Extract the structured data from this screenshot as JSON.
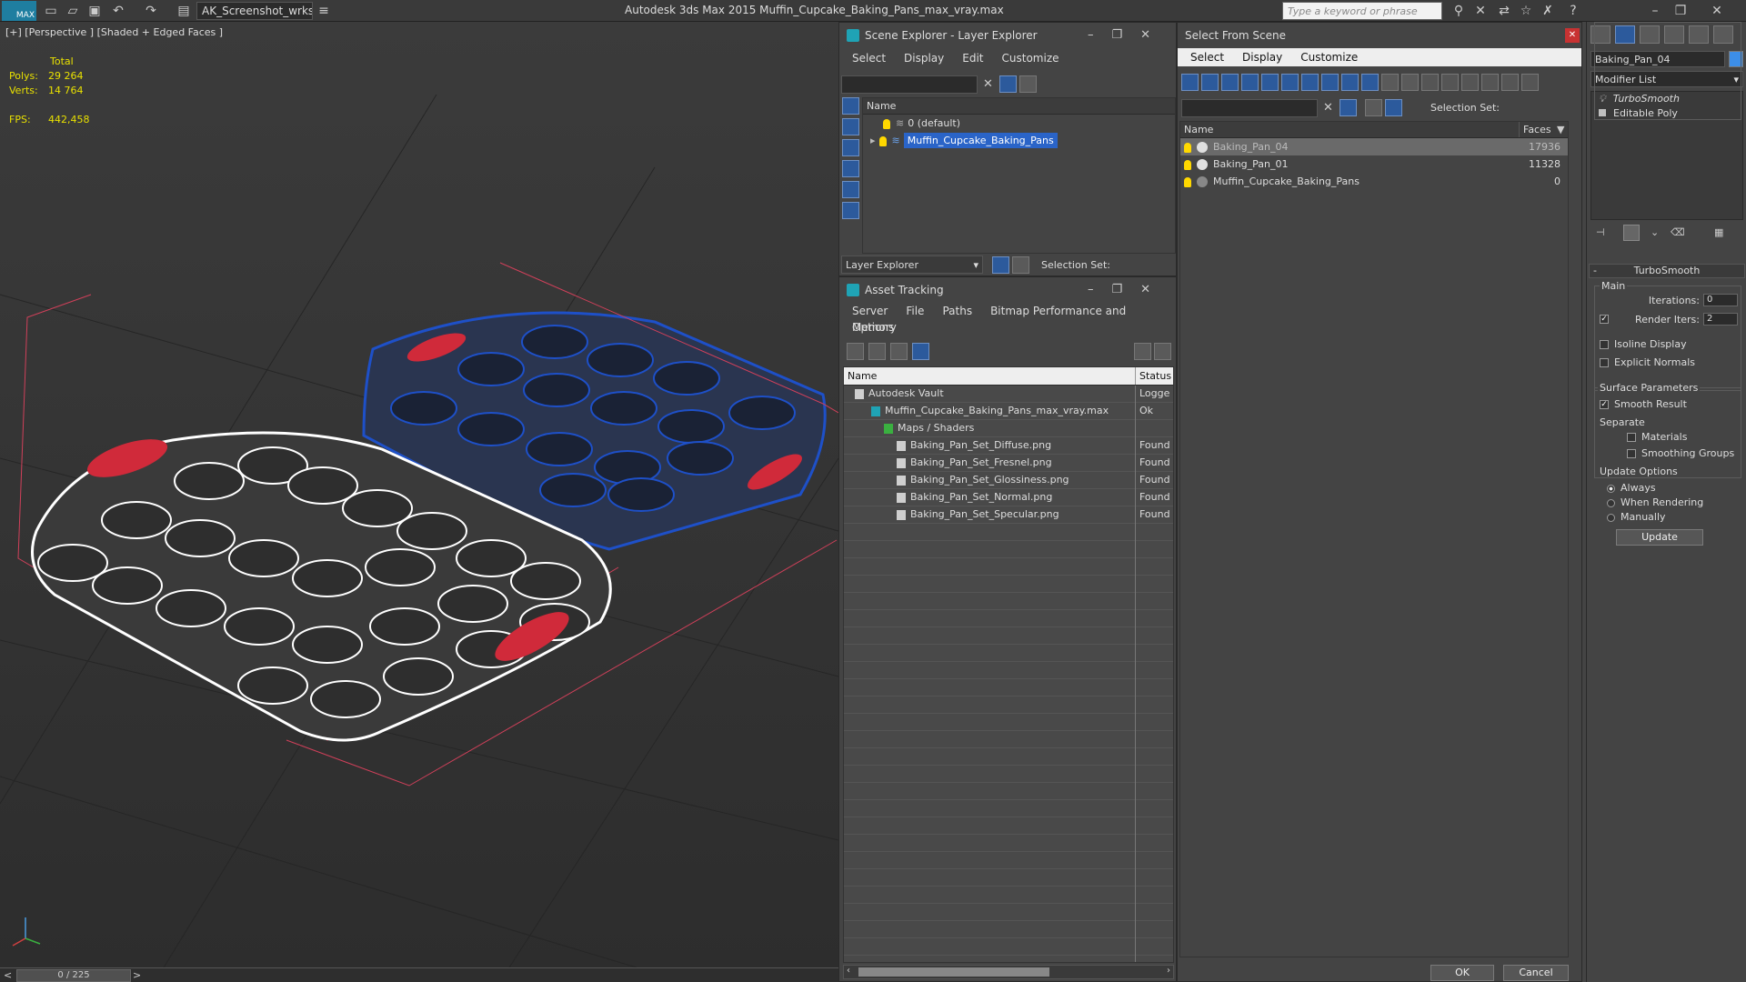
{
  "app": {
    "title": "Autodesk 3ds Max  2015    Muffin_Cupcake_Baking_Pans_max_vray.max",
    "workspace": "AK_Screenshot_wrksp",
    "search_placeholder": "Type a keyword or phrase",
    "logo": "MAX"
  },
  "viewport": {
    "label": "[+] [Perspective ] [Shaded + Edged Faces ]",
    "stats": {
      "header": "Total",
      "polys_label": "Polys:",
      "polys": "29 264",
      "verts_label": "Verts:",
      "verts": "14 764",
      "fps_label": "FPS:",
      "fps": "442,458"
    },
    "timeline": "0 / 225",
    "prev": "<",
    "next": ">"
  },
  "scene_explorer": {
    "title": "Scene Explorer - Layer Explorer",
    "menu": [
      "Select",
      "Display",
      "Edit",
      "Customize"
    ],
    "column": "Name",
    "rows": [
      "0 (default)",
      "Muffin_Cupcake_Baking_Pans"
    ],
    "footer_dropdown": "Layer Explorer",
    "selection_set": "Selection Set:"
  },
  "asset_tracking": {
    "title": "Asset Tracking",
    "menu": [
      "Server",
      "File",
      "Paths",
      "Bitmap Performance and Memory"
    ],
    "menu2": "Options",
    "col_name": "Name",
    "col_status": "Status",
    "rows": [
      {
        "name": "Autodesk Vault",
        "status": "Logge"
      },
      {
        "name": "Muffin_Cupcake_Baking_Pans_max_vray.max",
        "status": "Ok"
      },
      {
        "name": "Maps / Shaders",
        "status": ""
      },
      {
        "name": "Baking_Pan_Set_Diffuse.png",
        "status": "Found"
      },
      {
        "name": "Baking_Pan_Set_Fresnel.png",
        "status": "Found"
      },
      {
        "name": "Baking_Pan_Set_Glossiness.png",
        "status": "Found"
      },
      {
        "name": "Baking_Pan_Set_Normal.png",
        "status": "Found"
      },
      {
        "name": "Baking_Pan_Set_Specular.png",
        "status": "Found"
      }
    ]
  },
  "select_from_scene": {
    "title": "Select From Scene",
    "menu": [
      "Select",
      "Display",
      "Customize"
    ],
    "selection_set": "Selection Set:",
    "col_name": "Name",
    "col_faces": "Faces",
    "rows": [
      {
        "name": "Baking_Pan_04",
        "faces": "17936"
      },
      {
        "name": "Baking_Pan_01",
        "faces": "11328"
      },
      {
        "name": "Muffin_Cupcake_Baking_Pans",
        "faces": "0"
      }
    ],
    "ok": "OK",
    "cancel": "Cancel"
  },
  "command_panel": {
    "object_name": "Baking_Pan_04",
    "modifier_list": "Modifier List",
    "stack": [
      "TurboSmooth",
      "Editable Poly"
    ],
    "rollout": "TurboSmooth",
    "main": "Main",
    "iterations_label": "Iterations:",
    "iterations": "0",
    "render_iters_label": "Render Iters:",
    "render_iters": "2",
    "isoline": "Isoline Display",
    "explicit": "Explicit Normals",
    "surface": "Surface Parameters",
    "smooth": "Smooth Result",
    "separate": "Separate",
    "materials": "Materials",
    "smoothing": "Smoothing Groups",
    "update_options": "Update Options",
    "always": "Always",
    "when_rendering": "When Rendering",
    "manually": "Manually",
    "update": "Update",
    "rollout_minus": "-"
  },
  "colors": {
    "accent": "#2a64c8",
    "stats": "#e8e000",
    "wire_white": "#ffffff",
    "wire_blue": "#1e50c8",
    "handle_red": "#d02a3a"
  }
}
